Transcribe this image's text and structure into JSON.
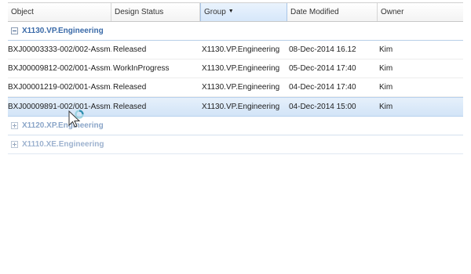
{
  "columns": {
    "object": "Object",
    "design_status": "Design Status",
    "group": "Group",
    "date_modified": "Date Modified",
    "owner": "Owner"
  },
  "groups": [
    {
      "name": "X1130.VP.Engineering",
      "expanded": true,
      "rows": [
        {
          "object": "BXJ00003333-002/002-Assm...",
          "status": "Released",
          "group": "X1130.VP.Engineering",
          "date": "08-Dec-2014 16.12",
          "owner": "Kim"
        },
        {
          "object": "BXJ00009812-002/001-Assm...",
          "status": "WorkInProgress",
          "group": "X1130.VP.Engineering",
          "date": "05-Dec-2014 17:40",
          "owner": "Kim"
        },
        {
          "object": "BXJ00001219-002/001-Assm...",
          "status": "Released",
          "group": "X1130.VP.Engineering",
          "date": "04-Dec-2014 17:40",
          "owner": "Kim"
        },
        {
          "object": "BXJ00009891-002/001-Assm...",
          "status": "Released",
          "group": "X1130.VP.Engineering",
          "date": "04-Dec-2014 15:00",
          "owner": "Kim",
          "selected": true
        }
      ]
    },
    {
      "name": "X1120.XP.Engineering",
      "expanded": false
    },
    {
      "name": "X1110.XE.Engineering",
      "expanded": false
    }
  ],
  "icons": {
    "sort": "sort-descending-icon",
    "collapse": "minus-box-icon",
    "expand": "plus-box-icon",
    "cursor": "busy-pointer-icon"
  },
  "colors": {
    "group_text": "#3a6aa8",
    "selected_row": "#d2e4f7",
    "sorted_header": "#d6e7fa"
  }
}
